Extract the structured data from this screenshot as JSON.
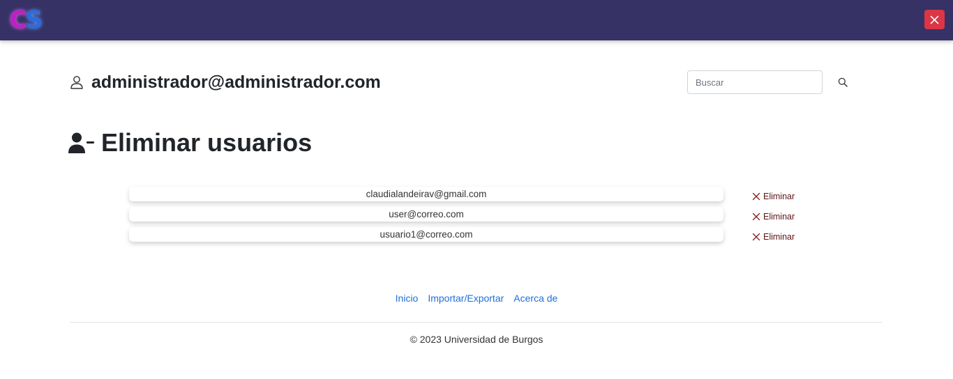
{
  "header": {
    "logo_text_c": "C",
    "logo_text_s": "S",
    "accent_color": "#363266",
    "close_color": "#dc3545"
  },
  "account": {
    "email": "administrador@administrador.com"
  },
  "search": {
    "placeholder": "Buscar",
    "value": ""
  },
  "page": {
    "title": "Eliminar usuarios"
  },
  "users": [
    {
      "email": "claudialandeirav@gmail.com",
      "delete_label": "Eliminar"
    },
    {
      "email": "user@correo.com",
      "delete_label": "Eliminar"
    },
    {
      "email": "usuario1@correo.com",
      "delete_label": "Eliminar"
    }
  ],
  "footer": {
    "links": [
      "Inicio",
      "Importar/Exportar",
      "Acerca de"
    ],
    "copyright": "© 2023 Universidad de Burgos"
  }
}
